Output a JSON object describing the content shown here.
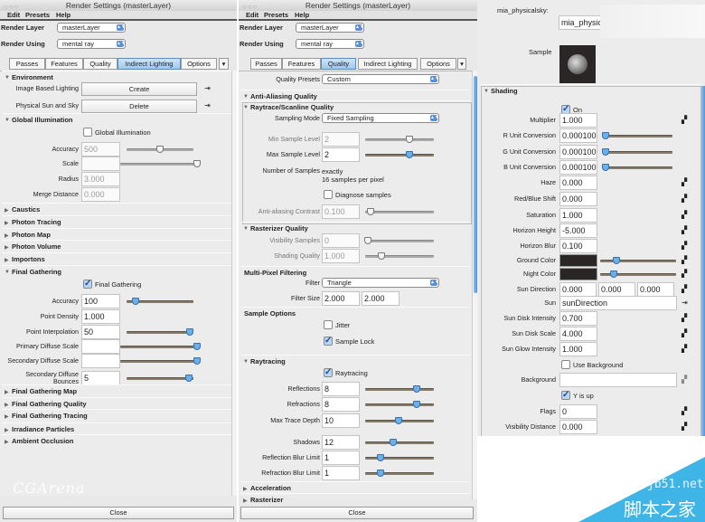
{
  "left": {
    "title": "Render Settings (masterLayer)",
    "menu": [
      "Edit",
      "Presets",
      "Help"
    ],
    "render_layer_label": "Render Layer",
    "render_layer": "masterLayer",
    "render_using_label": "Render Using",
    "render_using": "mental ray",
    "tabs": [
      "Passes",
      "Features",
      "Quality",
      "Indirect Lighting",
      "Options"
    ],
    "active_tab": 3,
    "close": "Close",
    "watermark": "CGArena",
    "content": [
      {
        "type": "header",
        "label": "Environment",
        "expanded": true
      },
      {
        "type": "button",
        "label": "Image Based Lighting",
        "value": "Create",
        "icon": "connect-icon"
      },
      {
        "type": "button",
        "label": "Physical Sun and Sky",
        "value": "Delete",
        "icon": "connect-icon"
      },
      {
        "type": "header",
        "label": "Global Illumination",
        "expanded": true
      },
      {
        "type": "checkbox",
        "label": "Global Illumination",
        "checked": false
      },
      {
        "type": "field",
        "label": "Accuracy",
        "value": "500",
        "disabled": true,
        "slider": 0.5
      },
      {
        "type": "field",
        "label": "Scale",
        "value": "",
        "disabled": true,
        "slider": 1.0
      },
      {
        "type": "field",
        "label": "Radius",
        "value": "3.000",
        "disabled": true
      },
      {
        "type": "field",
        "label": "Merge Distance",
        "value": "0.000",
        "disabled": true
      },
      {
        "type": "header",
        "label": "Caustics",
        "expanded": false
      },
      {
        "type": "header",
        "label": "Photon Tracing",
        "expanded": false
      },
      {
        "type": "header",
        "label": "Photon Map",
        "expanded": false
      },
      {
        "type": "header",
        "label": "Photon Volume",
        "expanded": false
      },
      {
        "type": "header",
        "label": "Importons",
        "expanded": false
      },
      {
        "type": "header",
        "label": "Final Gathering",
        "expanded": true
      },
      {
        "type": "checkbox",
        "label": "Final Gathering",
        "checked": true
      },
      {
        "type": "field",
        "label": "Accuracy",
        "value": "100",
        "slider": 0.13
      },
      {
        "type": "field",
        "label": "Point Density",
        "value": "1.000"
      },
      {
        "type": "field",
        "label": "Point Interpolation",
        "value": "50",
        "slider": 0.95
      },
      {
        "type": "field",
        "label": "Primary Diffuse Scale",
        "value": "",
        "slider": 1.0
      },
      {
        "type": "field",
        "label": "Secondary Diffuse Scale",
        "value": "",
        "slider": 1.0
      },
      {
        "type": "field",
        "label": "Secondary Diffuse\nBounces",
        "value": "5",
        "slider": 0.93
      },
      {
        "type": "header",
        "label": "Final Gathering Map",
        "expanded": false
      },
      {
        "type": "header",
        "label": "Final Gathering Quality",
        "expanded": false
      },
      {
        "type": "header",
        "label": "Final Gathering Tracing",
        "expanded": false
      },
      {
        "type": "header",
        "label": "Irradiance Particles",
        "expanded": false
      },
      {
        "type": "header",
        "label": "Ambient Occlusion",
        "expanded": false
      }
    ]
  },
  "middle": {
    "title": "Render Settings (masterLayer)",
    "menu": [
      "Edit",
      "Presets",
      "Help"
    ],
    "render_layer_label": "Render Layer",
    "render_layer": "masterLayer",
    "render_using_label": "Render Using",
    "render_using": "mental ray",
    "tabs": [
      "Passes",
      "Features",
      "Quality",
      "Indirect Lighting",
      "Options"
    ],
    "active_tab": 2,
    "close": "Close",
    "content": [
      {
        "type": "select",
        "label": "Quality Presets",
        "value": "Custom"
      },
      {
        "type": "header",
        "label": "Anti-Aliasing Quality",
        "expanded": true
      },
      {
        "type": "header",
        "label": "Raytrace/Scanline Quality",
        "expanded": true
      },
      {
        "type": "select",
        "label": "Sampling Mode",
        "value": "Fixed Sampling"
      },
      {
        "type": "field",
        "label": "Min Sample Level",
        "value": "2",
        "disabled": true,
        "slider": 0.65
      },
      {
        "type": "field",
        "label": "Max Sample Level",
        "value": "2",
        "slider": 0.65
      },
      {
        "type": "text",
        "label": "Number of Samples",
        "value": "exactly\n16 samples per pixel"
      },
      {
        "type": "checkbox",
        "label": "Diagnose samples",
        "checked": false
      },
      {
        "type": "field",
        "label": "Anti-aliasing Contrast",
        "value": "0.100",
        "disabled": true,
        "slider": 0.08
      },
      {
        "type": "header",
        "label": "Rasterizer Quality",
        "expanded": true
      },
      {
        "type": "field",
        "label": "Visibility Samples",
        "value": "0",
        "disabled": true,
        "slider": 0.04
      },
      {
        "type": "field",
        "label": "Shading Quality",
        "value": "1.000",
        "disabled": true,
        "slider": 0.24
      },
      {
        "type": "header",
        "label": "Multi-Pixel Filtering"
      },
      {
        "type": "select",
        "label": "Filter",
        "value": "Triangle"
      },
      {
        "type": "pair",
        "label": "Filter Size",
        "values": [
          "2.000",
          "2.000"
        ]
      },
      {
        "type": "header",
        "label": "Sample Options"
      },
      {
        "type": "checkbox",
        "label": "Jitter",
        "checked": false
      },
      {
        "type": "checkbox",
        "label": "Sample Lock",
        "checked": true
      },
      {
        "type": "header",
        "label": "Raytracing",
        "expanded": true
      },
      {
        "type": "checkbox",
        "label": "Raytracing",
        "checked": true
      },
      {
        "type": "field",
        "label": "Reflections",
        "value": "8",
        "slider": 0.75
      },
      {
        "type": "field",
        "label": "Refractions",
        "value": "8",
        "slider": 0.75
      },
      {
        "type": "field",
        "label": "Max Trace Depth",
        "value": "10",
        "slider": 0.49
      },
      {
        "type": "field",
        "label": "Shadows",
        "value": "12",
        "slider": 0.41
      },
      {
        "type": "field",
        "label": "Reflection Blur Limit",
        "value": "1",
        "slider": 0.23
      },
      {
        "type": "field",
        "label": "Refraction Blur Limit",
        "value": "1",
        "slider": 0.23
      },
      {
        "type": "header",
        "label": "Acceleration",
        "expanded": false
      },
      {
        "type": "header",
        "label": "Rasterizer",
        "expanded": false
      }
    ]
  },
  "right": {
    "node_label": "mia_physicalsky:",
    "node_name": "mia_physic",
    "sample_label": "Sample",
    "content": [
      {
        "type": "header",
        "label": "Shading",
        "expanded": true
      },
      {
        "type": "checkbox",
        "label": "On",
        "checked": true
      },
      {
        "type": "field",
        "label": "Multiplier",
        "value": "1.000",
        "map": true
      },
      {
        "type": "field",
        "label": "R Unit Conversion",
        "value": "0.000100",
        "slider": 0.03
      },
      {
        "type": "field",
        "label": "G Unit Conversion",
        "value": "0.000100",
        "slider": 0.03
      },
      {
        "type": "field",
        "label": "B Unit Conversion",
        "value": "0.000100",
        "slider": 0.03
      },
      {
        "type": "field",
        "label": "Haze",
        "value": "0.000",
        "map": true
      },
      {
        "type": "field",
        "label": "Red/Blue Shift",
        "value": "0.000",
        "map": true
      },
      {
        "type": "field",
        "label": "Saturation",
        "value": "1.000",
        "map": true
      },
      {
        "type": "field",
        "label": "Horizon Height",
        "value": "-5.000",
        "map": true
      },
      {
        "type": "field",
        "label": "Horizon Blur",
        "value": "0.100",
        "map": true
      },
      {
        "type": "color",
        "label": "Ground Color",
        "color": "#2a2626",
        "slider": 0.22,
        "map": true
      },
      {
        "type": "color",
        "label": "Night Color",
        "color": "#2a2626",
        "slider": 0.18,
        "map": true
      },
      {
        "type": "triple",
        "label": "Sun Direction",
        "values": [
          "0.000",
          "0.000",
          "0.000"
        ],
        "map": true
      },
      {
        "type": "wide",
        "label": "Sun",
        "value": "sunDirection",
        "connect": true
      },
      {
        "type": "field",
        "label": "Sun Disk Intensity",
        "value": "0.700",
        "map": true
      },
      {
        "type": "field",
        "label": "Sun Disk Scale",
        "value": "4.000",
        "map": true
      },
      {
        "type": "field",
        "label": "Sun Glow Intensity",
        "value": "1.000",
        "map": true
      },
      {
        "type": "checkbox",
        "label": "Use Background",
        "checked": false
      },
      {
        "type": "wide",
        "label": "Background",
        "value": "",
        "map": true
      },
      {
        "type": "checkbox",
        "label": "Y is up",
        "checked": true
      },
      {
        "type": "field",
        "label": "Flags",
        "value": "0",
        "map": true
      },
      {
        "type": "field",
        "label": "Visibility Distance",
        "value": "0.000",
        "map": true
      }
    ]
  },
  "watermark": {
    "site": "jb51.net",
    "name": "脚本之家",
    "color": "#3fb4e6"
  },
  "colors": {
    "accent": "#6ab0ec",
    "panel": "#ececec"
  }
}
